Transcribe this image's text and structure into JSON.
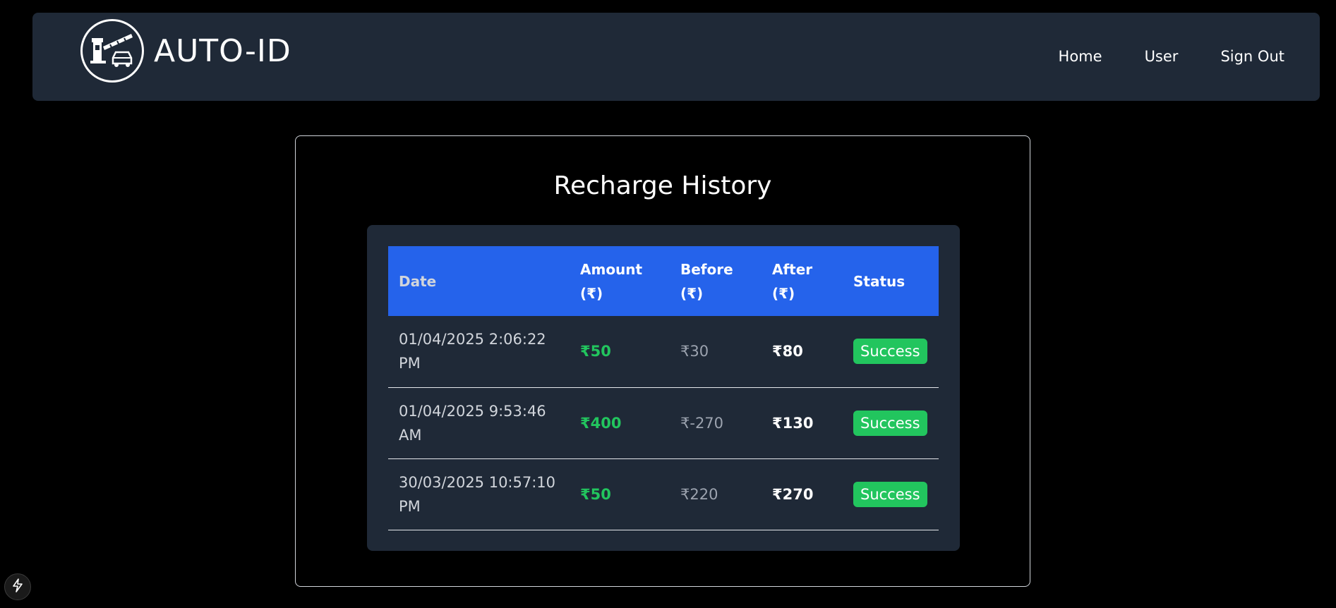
{
  "app": {
    "brand_name": "AUTO-ID",
    "logo_icon": "toll-gate-car-icon"
  },
  "nav": {
    "items": [
      {
        "label": "Home"
      },
      {
        "label": "User"
      },
      {
        "label": "Sign Out"
      }
    ]
  },
  "page": {
    "title": "Recharge History"
  },
  "table": {
    "headers": {
      "date": "Date",
      "amount": "Amount (₹)",
      "before": "Before (₹)",
      "after": "After (₹)",
      "status": "Status"
    },
    "rows": [
      {
        "date": "01/04/2025 2:06:22 PM",
        "amount": "₹50",
        "before": "₹30",
        "after": "₹80",
        "status": "Success"
      },
      {
        "date": "01/04/2025 9:53:46 AM",
        "amount": "₹400",
        "before": "₹-270",
        "after": "₹130",
        "status": "Success"
      },
      {
        "date": "30/03/2025 10:57:10 PM",
        "amount": "₹50",
        "before": "₹220",
        "after": "₹270",
        "status": "Success"
      }
    ]
  },
  "colors": {
    "navbar_bg": "#1f2937",
    "header_blue": "#2563eb",
    "success_green": "#22c55e"
  },
  "dev_indicator": {
    "icon": "lightning-icon"
  }
}
